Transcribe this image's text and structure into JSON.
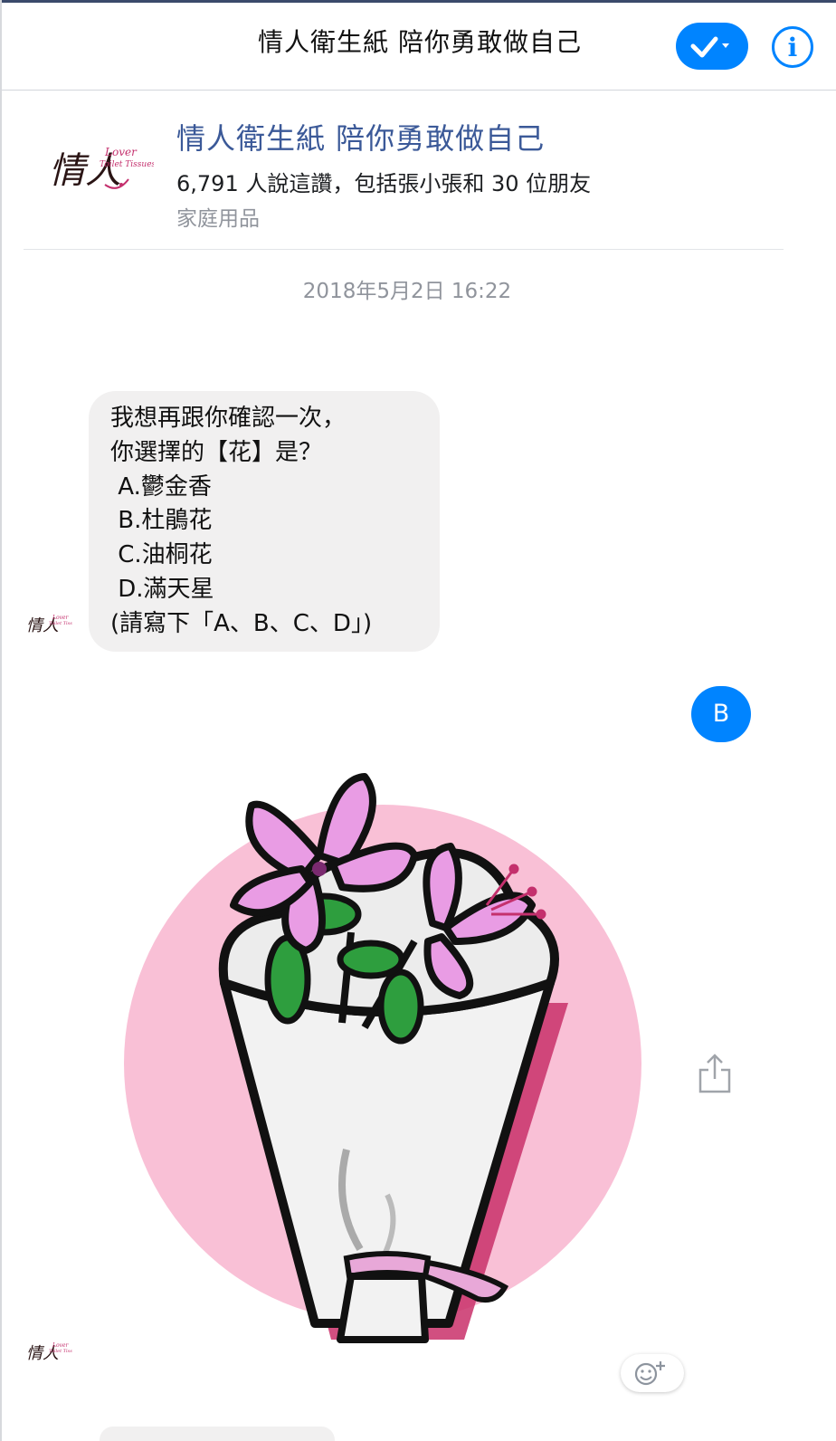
{
  "header": {
    "title": "情人衛生紙 陪你勇敢做自己",
    "done_icon": "checkmark-dropdown-icon",
    "info_icon": "info-icon",
    "info_glyph": "i",
    "accent_color": "#0084ff"
  },
  "page_card": {
    "logo_text": "情人",
    "logo_brand": "Lover",
    "logo_sub": "Toilet Tissues",
    "name": "情人衛生紙 陪你勇敢做自己",
    "likes": "6,791 人說這讚，包括張小張和 30 位朋友",
    "category": "家庭用品"
  },
  "conversation": {
    "timestamp": "2018年5月2日 16:22",
    "incoming_message": {
      "lines": [
        "我想再跟你確認一次，",
        "你選擇的【花】是？",
        " A.鬱金香",
        " B.杜鵑花",
        " C.油桐花",
        " D.滿天星",
        "(請寫下「A、B、C、D」)"
      ]
    },
    "outgoing_message": {
      "text": "B"
    },
    "sticker": {
      "description_icon": "azalea-bouquet-sticker"
    },
    "share_icon": "share-icon",
    "reaction_icon": "add-reaction-icon"
  }
}
